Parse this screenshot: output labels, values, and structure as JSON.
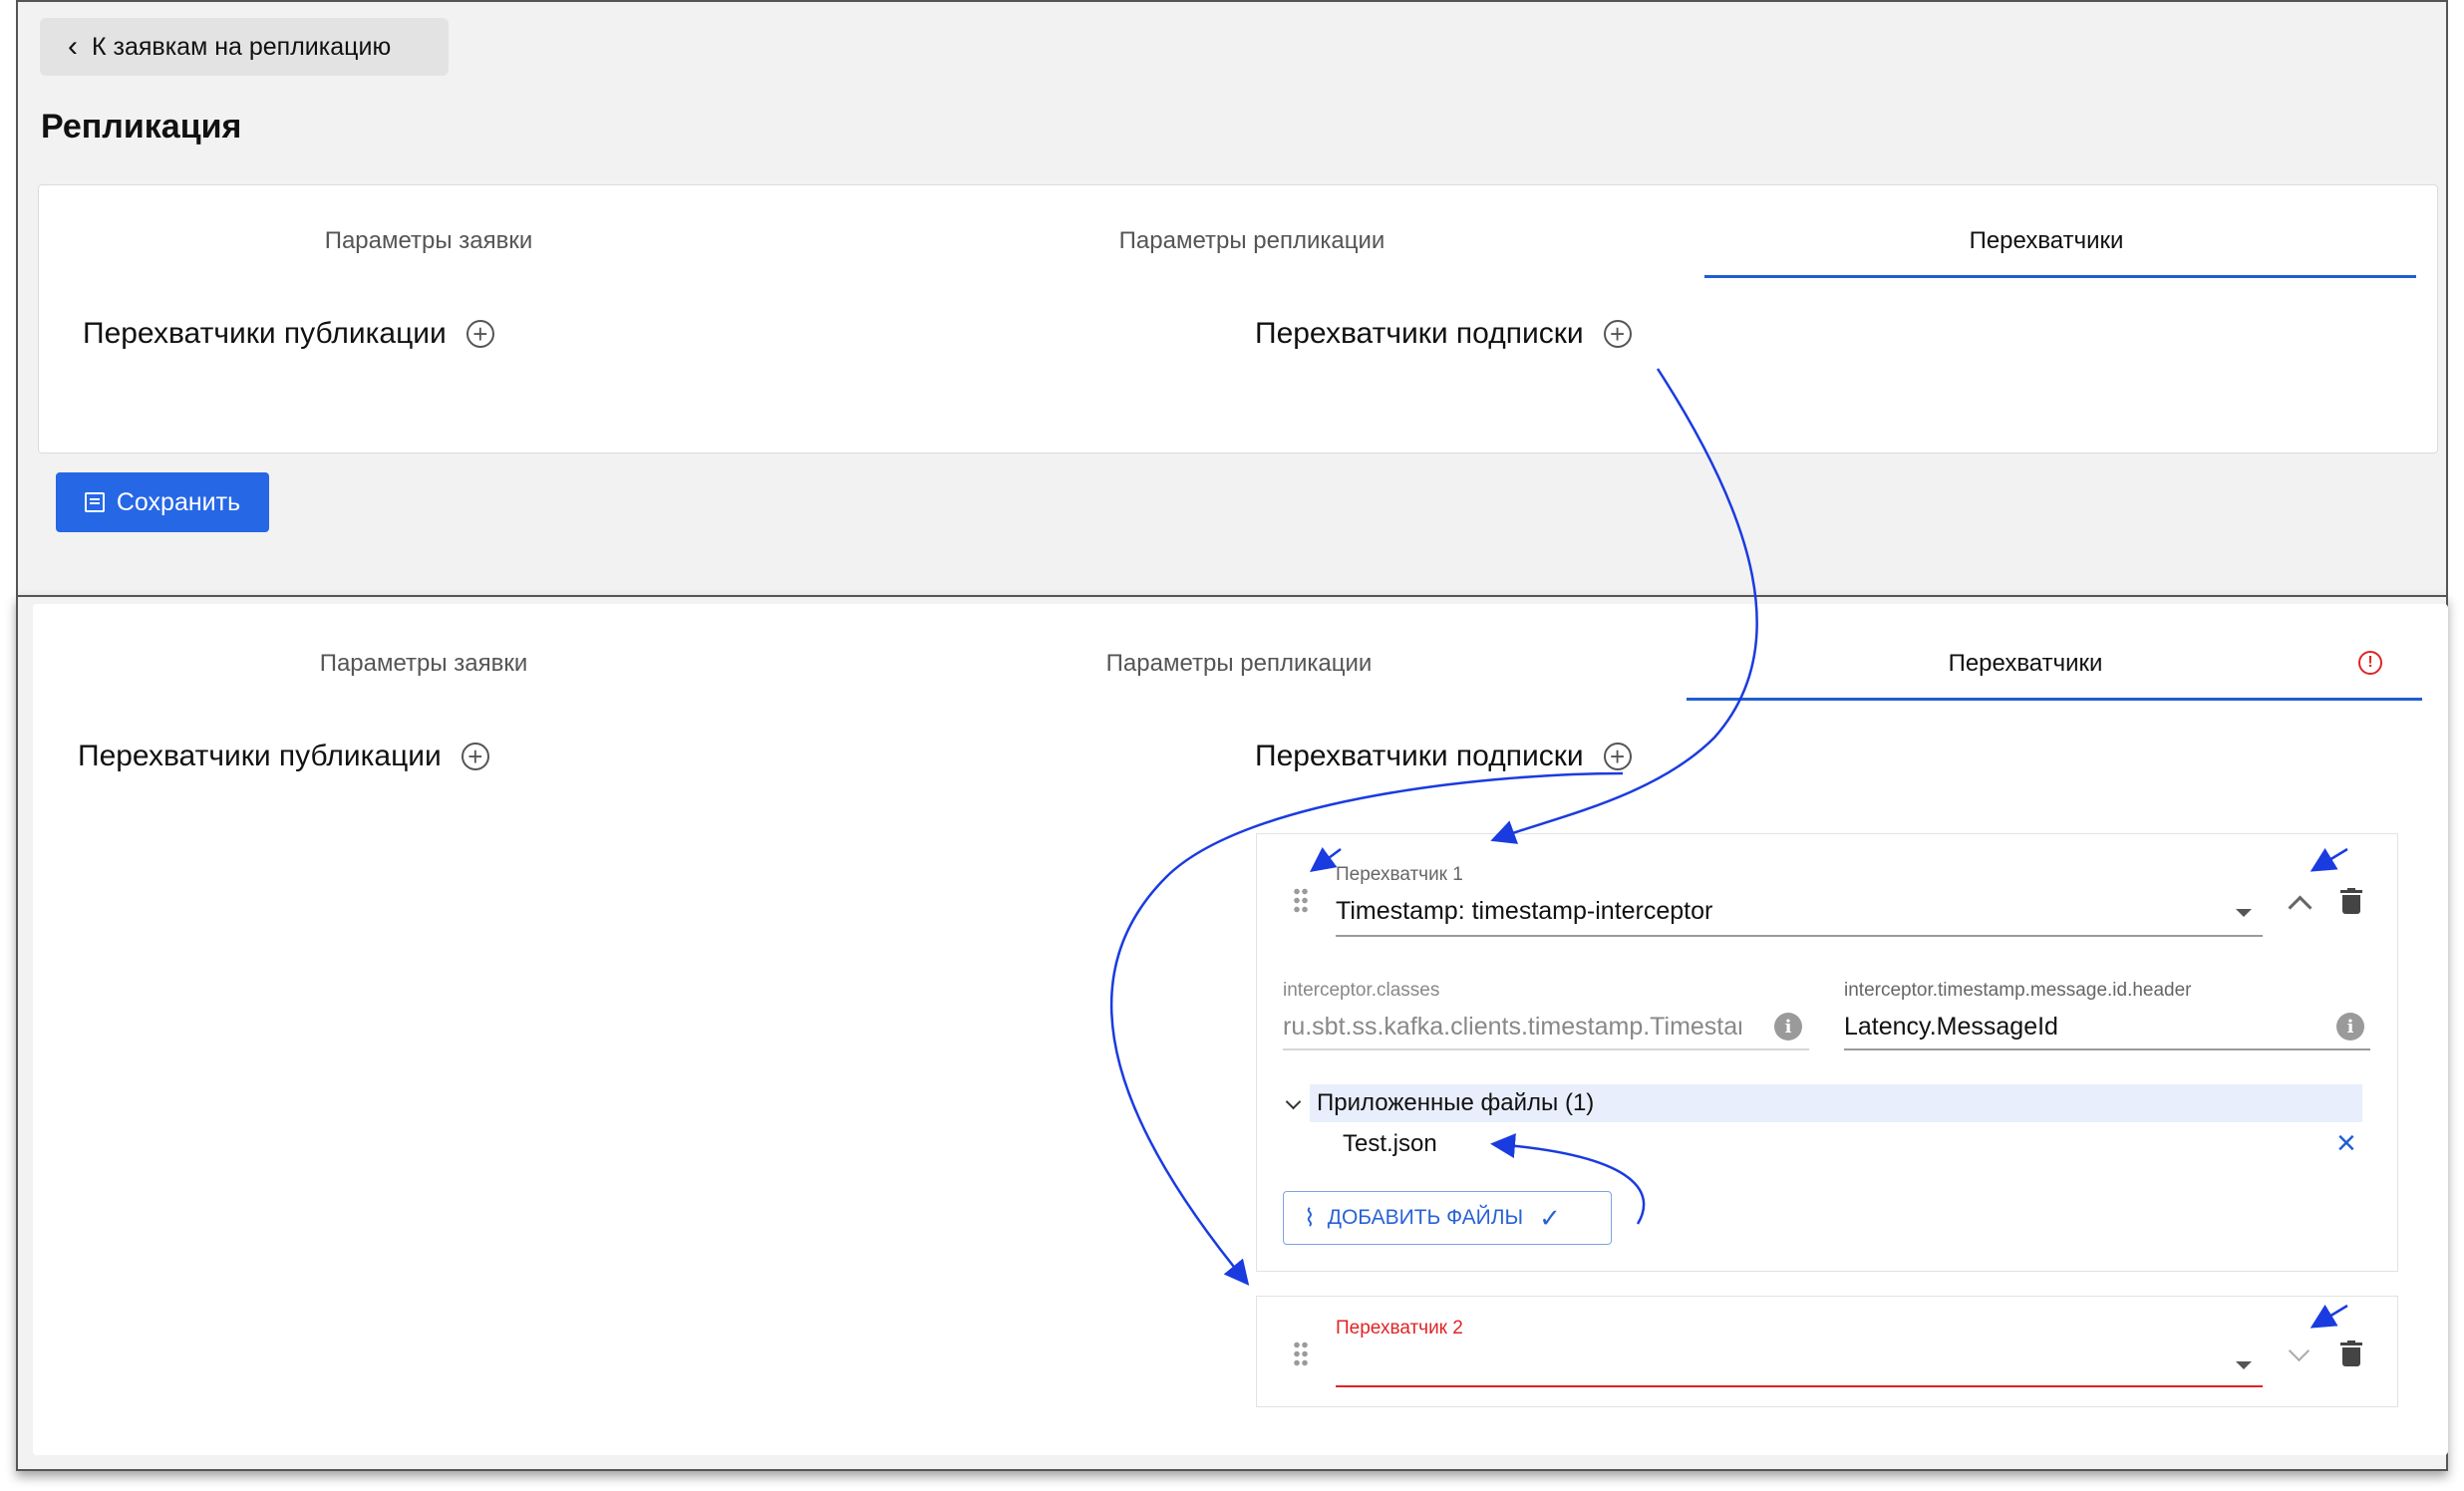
{
  "top": {
    "back_label": "К заявкам на репликацию",
    "page_title": "Репликация",
    "tabs": [
      {
        "label": "Параметры заявки"
      },
      {
        "label": "Параметры репликации"
      },
      {
        "label": "Перехватчики"
      }
    ],
    "publication_label": "Перехватчики публикации",
    "subscription_label": "Перехватчики подписки",
    "save_label": "Сохранить"
  },
  "bottom": {
    "tabs": [
      {
        "label": "Параметры заявки"
      },
      {
        "label": "Параметры репликации"
      },
      {
        "label": "Перехватчики"
      }
    ],
    "publication_label": "Перехватчики публикации",
    "subscription_label": "Перехватчики подписки",
    "interceptor1": {
      "label": "Перехватчик 1",
      "value": "Timestamp: timestamp-interceptor",
      "classes_label": "interceptor.classes",
      "classes_value": "ru.sbt.ss.kafka.clients.timestamp.TimestampInterceptor",
      "header_label": "interceptor.timestamp.message.id.header",
      "header_value": "Latency.MessageId",
      "attachments_label": "Приложенные файлы (1)",
      "file_name": "Test.json",
      "add_files_label": "ДОБАВИТЬ ФАЙЛЫ"
    },
    "interceptor2": {
      "label": "Перехватчик 2",
      "value": ""
    }
  },
  "colors": {
    "accent": "#2667e6",
    "tab_underline": "#1f5ed1",
    "error": "#e02424",
    "annotation_arrow": "#1a3be0"
  }
}
